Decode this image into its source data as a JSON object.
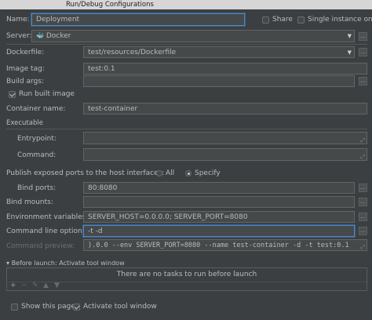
{
  "window": {
    "title": "Run/Debug Configurations"
  },
  "name": {
    "label": "Name:",
    "value": "Deployment"
  },
  "share": {
    "label": "Share",
    "checked": false
  },
  "single_instance": {
    "label": "Single instance only",
    "checked": false
  },
  "server": {
    "label": "Server:",
    "value": "Docker",
    "icon": "docker-icon"
  },
  "dockerfile": {
    "label": "Dockerfile:",
    "value": "test/resources/Dockerfile"
  },
  "image_tag": {
    "label": "Image tag:",
    "value": "test:0.1"
  },
  "build_args": {
    "label": "Build args:",
    "value": ""
  },
  "run_built_image": {
    "label": "Run built image",
    "checked": true
  },
  "container_name": {
    "label": "Container name:",
    "value": "test-container"
  },
  "executable": {
    "section_label": "Executable",
    "entrypoint_label": "Entrypoint:",
    "entrypoint_value": "",
    "command_label": "Command:",
    "command_value": ""
  },
  "publish_ports": {
    "label": "Publish exposed ports to the host interfaces:",
    "options": [
      "All",
      "Specify"
    ],
    "selected": "Specify"
  },
  "bind_ports": {
    "label": "Bind ports:",
    "value": "80:8080"
  },
  "bind_mounts": {
    "label": "Bind mounts:",
    "value": ""
  },
  "env_vars": {
    "label": "Environment variables:",
    "value": "SERVER_HOST=0.0.0.0; SERVER_PORT=8080"
  },
  "cmd_options": {
    "label": "Command line options:",
    "value": "-t -d"
  },
  "cmd_preview": {
    "label": "Command preview:",
    "value": ").0.0 --env SERVER_PORT=8080 --name test-container -d -t test:0.1"
  },
  "before_launch": {
    "label": "Before launch: Activate tool window",
    "empty_text": "There are no tasks to run before launch",
    "toolbar": [
      "+",
      "−",
      "✎",
      "▲",
      "▼"
    ]
  },
  "show_this_page": {
    "label": "Show this page",
    "checked": false
  },
  "activate_tool_window": {
    "label": "Activate tool window",
    "checked": true
  },
  "colors": {
    "background": "#3c3f41",
    "field_bg": "#45494a",
    "focus": "#4a88c7",
    "text": "#bbbbbb"
  }
}
